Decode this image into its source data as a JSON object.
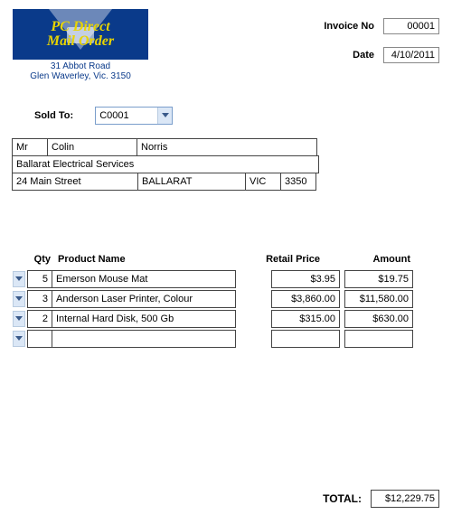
{
  "company": {
    "logo_line1": "PC Direct",
    "logo_line2": "Mail Order",
    "address_line1": "31 Abbot Road",
    "address_line2": "Glen Waverley, Vic. 3150"
  },
  "invoice": {
    "no_label": "Invoice No",
    "no_value": "00001",
    "date_label": "Date",
    "date_value": "4/10/2011"
  },
  "sold_to": {
    "label": "Sold To:",
    "customer_code": "C0001",
    "title": "Mr",
    "first_name": "Colin",
    "last_name": "Norris",
    "company": "Ballarat Electrical Services",
    "street": "24 Main Street",
    "city": "BALLARAT",
    "state": "VIC",
    "postcode": "3350"
  },
  "columns": {
    "qty": "Qty",
    "product": "Product Name",
    "retail": "Retail Price",
    "amount": "Amount"
  },
  "lines": [
    {
      "qty": "5",
      "name": "Emerson Mouse Mat",
      "retail": "$3.95",
      "amount": "$19.75"
    },
    {
      "qty": "3",
      "name": "Anderson Laser Printer, Colour",
      "retail": "$3,860.00",
      "amount": "$11,580.00"
    },
    {
      "qty": "2",
      "name": "Internal Hard Disk, 500 Gb",
      "retail": "$315.00",
      "amount": "$630.00"
    },
    {
      "qty": "",
      "name": "",
      "retail": "",
      "amount": ""
    }
  ],
  "total": {
    "label": "TOTAL:",
    "value": "$12,229.75"
  }
}
